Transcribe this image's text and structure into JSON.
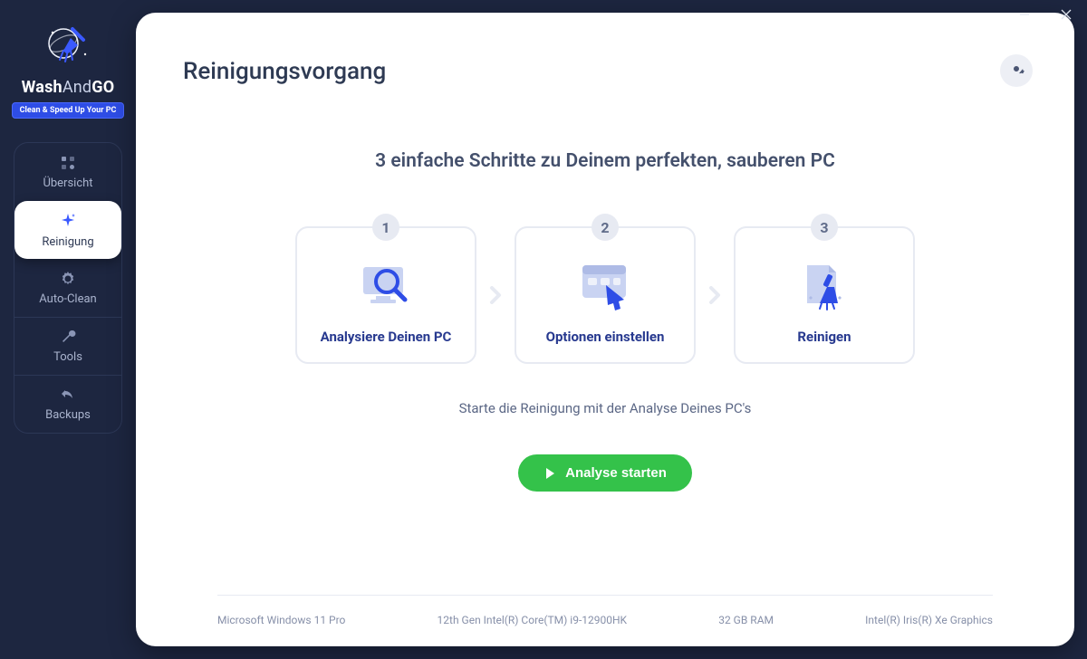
{
  "brand": {
    "name_part1": "Wash",
    "name_part2": "And",
    "name_part3": "GO",
    "tagline": "Clean & Speed Up Your PC"
  },
  "sidebar": {
    "items": [
      {
        "label": "Übersicht"
      },
      {
        "label": "Reinigung"
      },
      {
        "label": "Auto-Clean"
      },
      {
        "label": "Tools"
      },
      {
        "label": "Backups"
      }
    ]
  },
  "page": {
    "title": "Reinigungsvorgang",
    "headline": "3 einfache Schritte zu Deinem perfekten, sauberen PC",
    "steps": [
      {
        "num": "1",
        "label": "Analysiere Deinen PC"
      },
      {
        "num": "2",
        "label": "Optionen einstellen"
      },
      {
        "num": "3",
        "label": "Reinigen"
      }
    ],
    "subtext": "Starte die Reinigung mit der Analyse Deines PC's",
    "cta_label": "Analyse starten"
  },
  "footer": {
    "os": "Microsoft Windows 11 Pro",
    "cpu": "12th Gen Intel(R) Core(TM) i9-12900HK",
    "ram": "32 GB RAM",
    "gpu": "Intel(R) Iris(R) Xe Graphics"
  }
}
